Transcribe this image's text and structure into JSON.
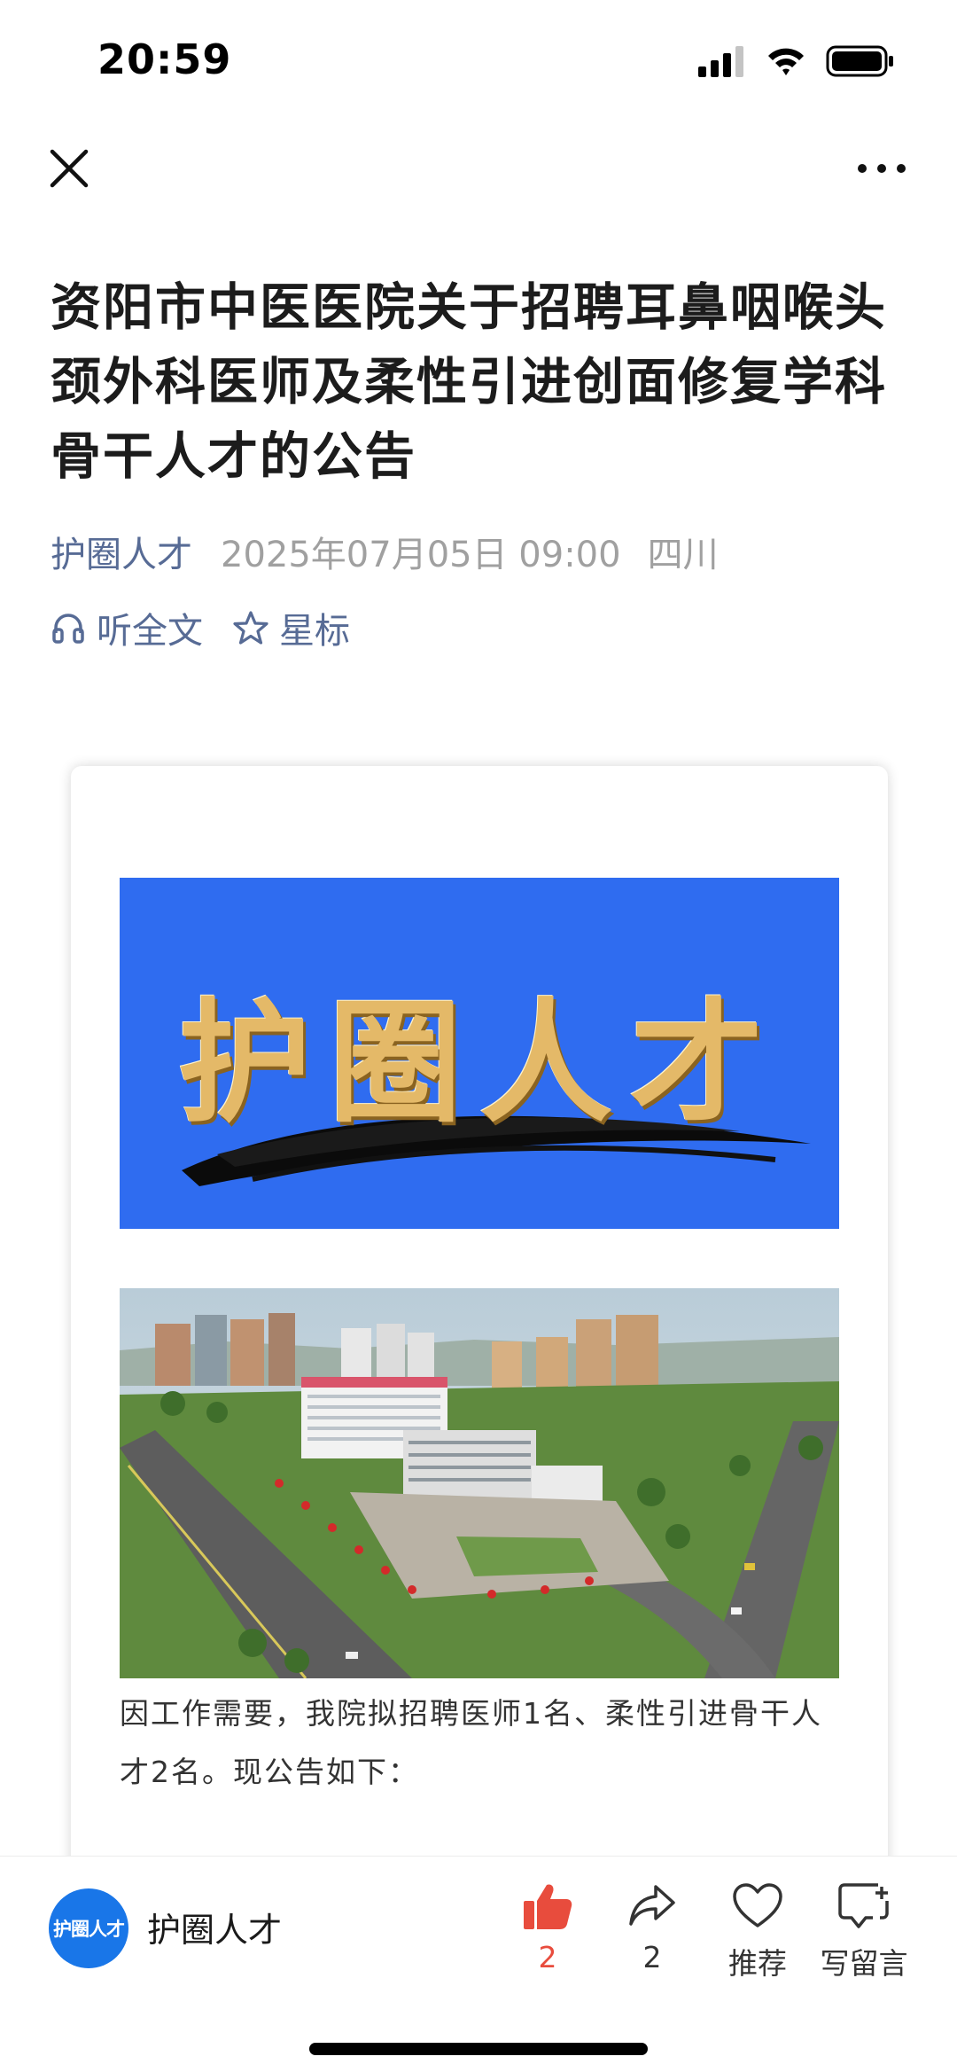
{
  "status_bar": {
    "time": "20:59"
  },
  "icons": {
    "close": "close-icon",
    "more": "more-icon",
    "headphones": "headphones-icon",
    "star": "star-icon",
    "like": "thumbs-up-icon",
    "share": "share-icon",
    "recommend": "heart-icon",
    "comment": "comment-icon"
  },
  "article": {
    "title": "资阳市中医医院关于招聘耳鼻咽喉头颈外科医师及柔性引进创面修复学科骨干人才的公告",
    "account": "护圈人才",
    "date": "2025年07月05日 09:00",
    "location": "四川",
    "listen_label": "听全文",
    "star_label": "星标",
    "banner_text": "护圈人才",
    "body": "因工作需要，我院拟招聘医师1名、柔性引进骨干人才2名。现公告如下："
  },
  "bottom_bar": {
    "avatar_text": "护圈人才",
    "account_name": "护圈人才",
    "like_count": "2",
    "share_count": "2",
    "recommend_label": "推荐",
    "comment_label": "写留言"
  },
  "colors": {
    "link_blue": "#576b95",
    "banner_blue": "#2f6cf0",
    "like_red": "#e84c3d",
    "avatar_blue": "#1976e8"
  }
}
